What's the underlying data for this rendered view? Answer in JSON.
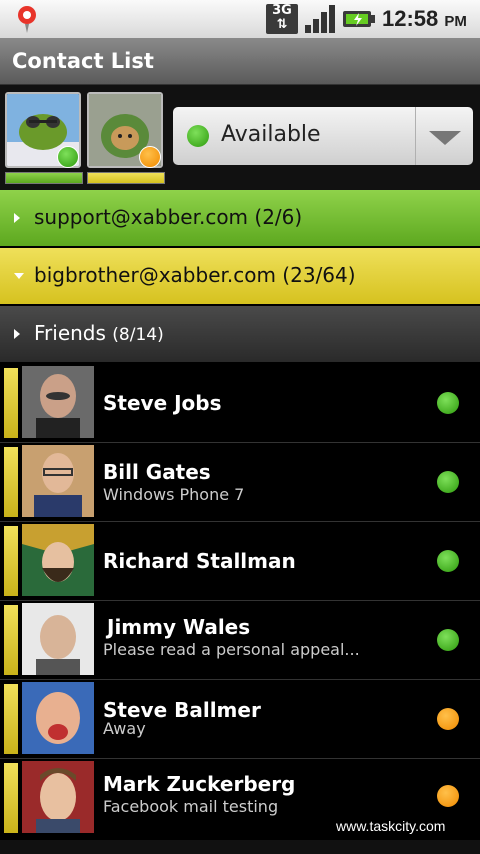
{
  "status_bar": {
    "network": "3G",
    "time": "12:58",
    "ampm": "PM"
  },
  "title": "Contact List",
  "accounts": [
    {
      "name": "support-account",
      "status": "online",
      "color": "#5da81f"
    },
    {
      "name": "bigbrother-account",
      "status": "away",
      "color": "#d6c21f"
    }
  ],
  "status_selector": {
    "value": "Available",
    "status_color": "#2d9a0c"
  },
  "groups": [
    {
      "label": "support@xabber.com (2/6)",
      "color": "#5da81f",
      "expanded": false
    },
    {
      "label": "bigbrother@xabber.com (23/64)",
      "color": "#d6c21f",
      "expanded": true
    },
    {
      "name": "Friends",
      "count": "(8/14)",
      "expanded": false
    }
  ],
  "contacts": [
    {
      "name": "Steve Jobs",
      "status_text": "",
      "presence": "online"
    },
    {
      "name": "Bill Gates",
      "status_text": "Windows Phone 7",
      "presence": "online"
    },
    {
      "name": "Richard Stallman",
      "status_text": "",
      "presence": "online"
    },
    {
      "name": "Jimmy Wales",
      "status_text": "Please read a personal appeal...",
      "presence": "online"
    },
    {
      "name": "Steve Ballmer",
      "status_text": "Away",
      "presence": "away"
    },
    {
      "name": "Mark Zuckerberg",
      "status_text": "Facebook mail testing",
      "presence": "away"
    }
  ],
  "watermark": "www.taskcity.com"
}
